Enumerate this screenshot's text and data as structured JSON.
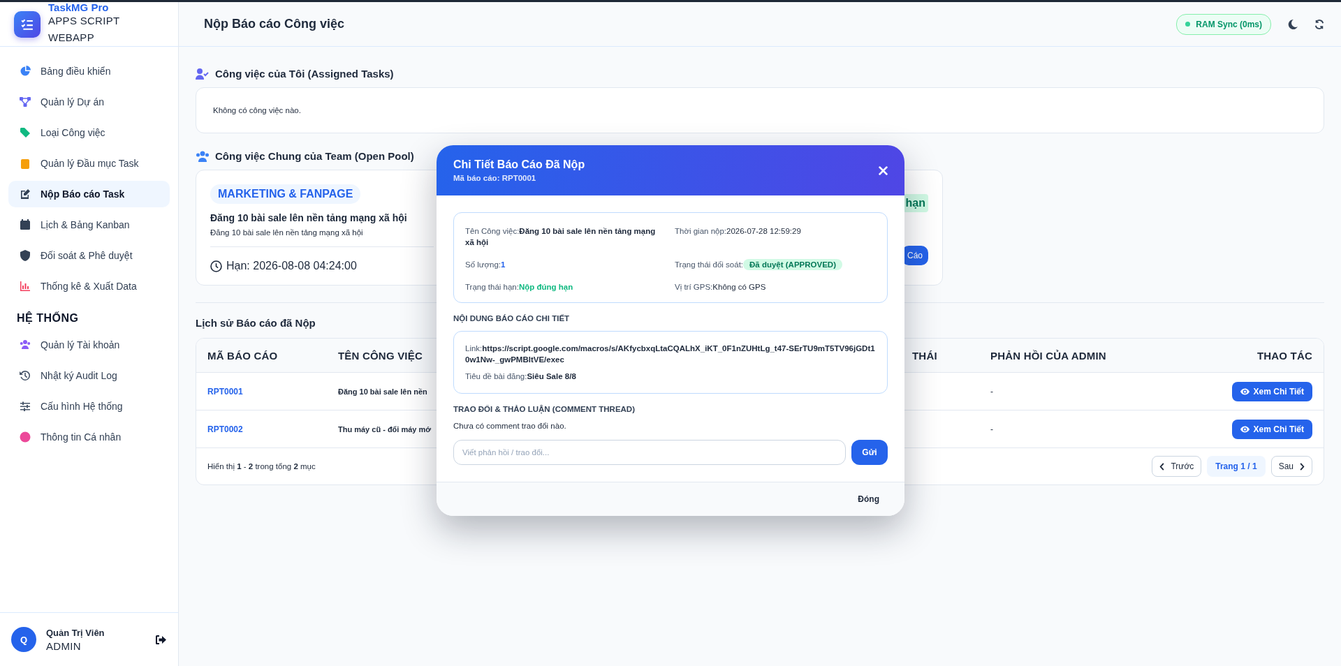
{
  "brand": {
    "name": "TaskMG Pro",
    "subtitle": "APPS SCRIPT WEBAPP"
  },
  "sidebar": {
    "items": [
      {
        "label": "Bảng điều khiển",
        "selected": false
      },
      {
        "label": "Quản lý Dự án",
        "selected": false
      },
      {
        "label": "Loại Công việc",
        "selected": false
      },
      {
        "label": "Quản lý Đầu mục Task",
        "selected": false
      },
      {
        "label": "Nộp Báo cáo Task",
        "selected": true
      },
      {
        "label": "Lịch & Bảng Kanban",
        "selected": false
      },
      {
        "label": "Đối soát & Phê duyệt",
        "selected": false
      },
      {
        "label": "Thống kê & Xuất Data",
        "selected": false
      }
    ],
    "section": "HỆ THỐNG",
    "system_items": [
      {
        "label": "Quản lý Tài khoản",
        "selected": false
      },
      {
        "label": "Nhật ký Audit Log",
        "selected": false
      },
      {
        "label": "Cấu hình Hệ thống",
        "selected": false
      },
      {
        "label": "Thông tin Cá nhân",
        "selected": false
      }
    ],
    "user": {
      "initial": "Q",
      "name": "Quản Trị Viên",
      "role": "ADMIN"
    }
  },
  "header": {
    "title": "Nộp Báo cáo Công việc",
    "sync": "RAM Sync (0ms)"
  },
  "assigned": {
    "title": "Công việc của Tôi (Assigned Tasks)",
    "empty": "Không có công việc nào."
  },
  "pool": {
    "title": "Công việc Chung của Team (Open Pool)",
    "card": {
      "category": "MARKETING & FANPAGE",
      "name": "Đăng 10 bài sale lên nền tảng mạng xã hội",
      "description": "Đăng 10 bài sale lên nền tảng mạng xã hội",
      "deadline": "Hạn: 2026-08-08 04:24:00",
      "badge": "hạn",
      "button": "Cáo"
    }
  },
  "history": {
    "title": "Lịch sử Báo cáo đã Nộp",
    "columns": [
      "MÃ BÁO CÁO",
      "TÊN CÔNG VIỆC",
      "THÁI",
      "PHẢN HỒI CỦA ADMIN",
      "THAO TÁC"
    ],
    "rows": [
      {
        "id": "RPT0001",
        "task": "Đăng 10 bài sale lên nền",
        "feedback": "-",
        "action": "Xem Chi Tiết"
      },
      {
        "id": "RPT0002",
        "task": "Thu máy cũ - đổi máy mớ",
        "feedback": "-",
        "action": "Xem Chi Tiết"
      }
    ],
    "summary": "Hiển thị **1** - **2** trong tổng **2** mục",
    "pager": {
      "prev": "Trước",
      "page": "Trang 1 / 1",
      "next": "Sau"
    }
  },
  "modal": {
    "title": "Chi Tiết Báo Cáo Đã Nộp",
    "subtitle": "Mã báo cáo: RPT0001",
    "fields": [
      {
        "label": "Tên Công việc:",
        "value": "Đăng 10 bài sale lên nền tảng mạng xã hội",
        "kind": "bold"
      },
      {
        "label": "Thời gian nộp:",
        "value": "2026-07-28 12:59:29",
        "kind": "plain"
      },
      {
        "label": "Số lượng:",
        "value": "1",
        "kind": "accent"
      },
      {
        "label": "Trạng thái đối soát:",
        "value": "Đã duyệt (APPROVED)",
        "kind": "badge"
      },
      {
        "label": "Trạng thái hạn:",
        "value": "Nộp đúng hạn",
        "kind": "success"
      },
      {
        "label": "Vị trí GPS:",
        "value": "Không có GPS",
        "kind": "plain"
      }
    ],
    "content_title": "NỘI DUNG BÁO CÁO CHI TIẾT",
    "content": [
      {
        "label": "Link:",
        "value": "https://script.google.com/macros/s/AKfycbxqLtaCQALhX_iKT_0F1nZUHtLg_t47-SErTU9mT5TV96jGDt10w1Nw-_gwPMBItVE/exec"
      },
      {
        "label": "Tiêu đề bài đăng:",
        "value": "Siêu Sale 8/8"
      }
    ],
    "comments_title": "TRAO ĐỔI & THẢO LUẬN (COMMENT THREAD)",
    "comments_empty": "Chưa có comment trao đổi nào.",
    "comment_placeholder": "Viết phản hồi / trao đổi...",
    "send": "Gửi",
    "close": "Đóng"
  }
}
